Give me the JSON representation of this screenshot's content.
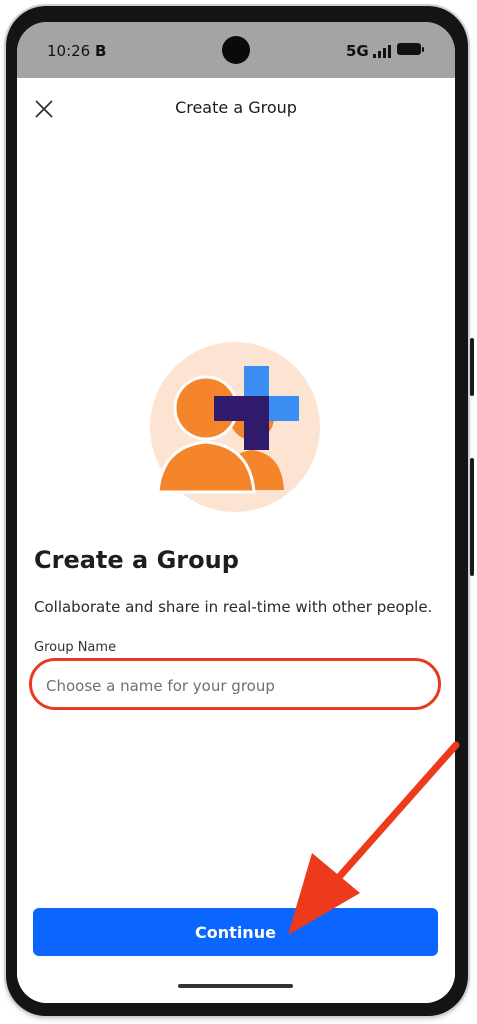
{
  "status_bar": {
    "time": "10:26",
    "indicator": "B",
    "network": "5G",
    "icons": [
      "signal-icon",
      "battery-icon"
    ]
  },
  "header": {
    "title": "Create a Group",
    "close_icon": "close-icon"
  },
  "illustration": {
    "icon": "add-group-icon",
    "colors": {
      "circle": "#fde3d2",
      "people": "#f5852b",
      "plus_light": "#3a8df2",
      "plus_dark": "#2f1a6b"
    }
  },
  "main": {
    "title": "Create a Group",
    "description": "Collaborate and share in real-time with other people.",
    "group_name_label": "Group Name",
    "group_name_placeholder": "Choose a name for your group",
    "group_name_value": ""
  },
  "footer": {
    "continue_label": "Continue"
  },
  "colors": {
    "accent": "#0a66ff",
    "annotation": "#e83a21"
  }
}
